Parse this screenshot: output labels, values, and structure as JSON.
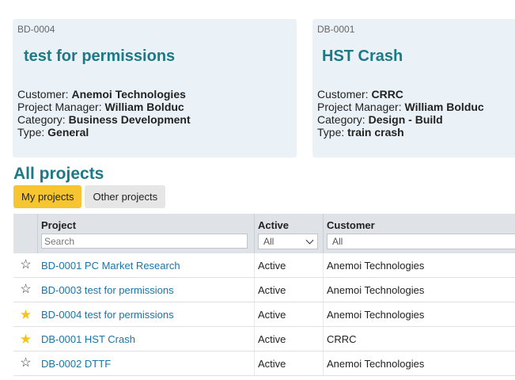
{
  "cards": [
    {
      "code": "BD-0004",
      "title": "test for permissions",
      "customer_label": "Customer:",
      "customer": "Anemoi Technologies",
      "pm_label": "Project Manager:",
      "pm": "William Bolduc",
      "category_label": "Category:",
      "category": "Business Development",
      "type_label": "Type:",
      "type": "General"
    },
    {
      "code": "DB-0001",
      "title": "HST Crash",
      "customer_label": "Customer:",
      "customer": "CRRC",
      "pm_label": "Project Manager:",
      "pm": "William Bolduc",
      "category_label": "Category:",
      "category": "Design - Build",
      "type_label": "Type:",
      "type": "train crash"
    }
  ],
  "section_title": "All projects",
  "tabs": [
    {
      "label": "My projects",
      "active": true
    },
    {
      "label": "Other projects",
      "active": false
    }
  ],
  "grid": {
    "columns": {
      "project": "Project",
      "active": "Active",
      "customer": "Customer"
    },
    "filters": {
      "project_placeholder": "Search",
      "active_value": "All",
      "customer_value": "All"
    },
    "rows": [
      {
        "starred": false,
        "project": "BD-0001 PC Market Research",
        "active": "Active",
        "customer": "Anemoi Technologies"
      },
      {
        "starred": false,
        "project": "BD-0003 test for permissions",
        "active": "Active",
        "customer": "Anemoi Technologies"
      },
      {
        "starred": true,
        "project": "BD-0004 test for permissions",
        "active": "Active",
        "customer": "Anemoi Technologies"
      },
      {
        "starred": true,
        "project": "DB-0001 HST Crash",
        "active": "Active",
        "customer": "CRRC"
      },
      {
        "starred": false,
        "project": "DB-0002 DTTF",
        "active": "Active",
        "customer": "Anemoi Technologies"
      }
    ]
  },
  "colors": {
    "accent": "#1b7a86",
    "tab_active": "#f7c531",
    "star_on": "#f6c319",
    "link": "#1a74a8",
    "card_bg": "#eaf2f8"
  },
  "icons": {
    "star_on": "★",
    "star_off": "☆"
  }
}
